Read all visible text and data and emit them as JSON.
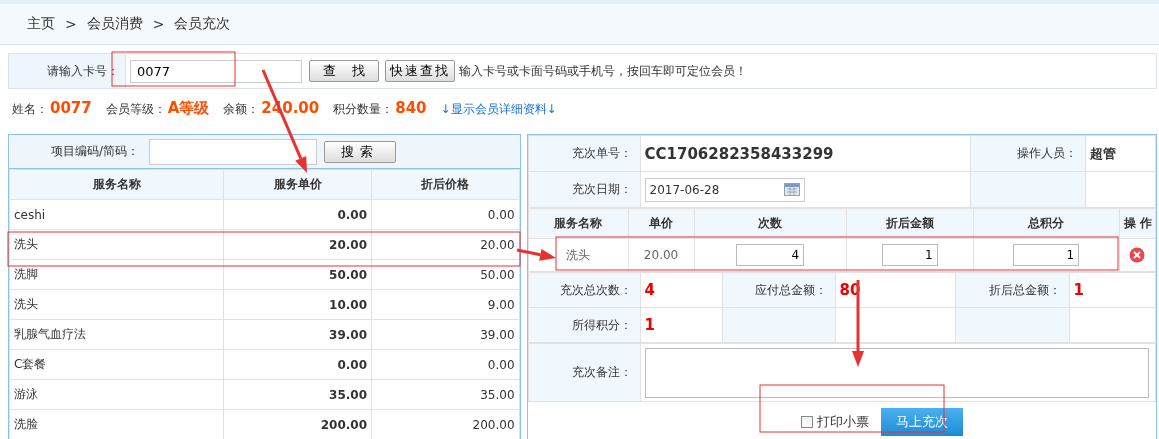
{
  "breadcrumb": [
    "主页",
    ">",
    "会员消费",
    ">",
    "会员充次"
  ],
  "card_search": {
    "label": "请输入卡号：",
    "value": "0077",
    "buttons": [
      "查 找",
      "快速查找"
    ],
    "hint": "输入卡号或卡面号码或手机号，按回车即可定位会员！"
  },
  "member_info": [
    {
      "label": "姓名：",
      "value": "0077"
    },
    {
      "label": "会员等级：",
      "value": "A等级"
    },
    {
      "label": "余额：",
      "value": "240.00"
    },
    {
      "label": "积分数量：",
      "value": "840"
    }
  ],
  "details_link": "↓显示会员详细资料↓",
  "service_panel": {
    "search_label": "项目编码/简码：",
    "search_button": "搜索",
    "columns": [
      "服务名称",
      "服务单价",
      "折后价格"
    ],
    "rows": [
      {
        "name": "ceshi",
        "price": "0.00",
        "discount_price": "0.00"
      },
      {
        "name": "洗头",
        "price": "20.00",
        "discount_price": "20.00"
      },
      {
        "name": "洗脚",
        "price": "50.00",
        "discount_price": "50.00"
      },
      {
        "name": "洗头",
        "price": "10.00",
        "discount_price": "9.00"
      },
      {
        "name": "乳腺气血疗法",
        "price": "39.00",
        "discount_price": "39.00"
      },
      {
        "name": "C套餐",
        "price": "0.00",
        "discount_price": "0.00"
      },
      {
        "name": "游泳",
        "price": "35.00",
        "discount_price": "35.00"
      },
      {
        "name": "洗脸",
        "price": "200.00",
        "discount_price": "200.00"
      }
    ]
  },
  "order_panel": {
    "order_no_label": "充次单号：",
    "order_no": "CC1706282358433299",
    "operator_label": "操作人员：",
    "operator": "超管",
    "date_label": "充次日期：",
    "date": "2017-06-28",
    "columns": [
      "服务名称",
      "单价",
      "次数",
      "折后金额",
      "总积分",
      "操 作"
    ],
    "items": [
      {
        "name": "洗头",
        "price": "20.00",
        "count": "4",
        "discount_amount": "1",
        "points": "1"
      }
    ],
    "totals": [
      {
        "label": "充次总次数：",
        "value": "4"
      },
      {
        "label": "应付总金额：",
        "value": "80"
      },
      {
        "label": "折后总金额：",
        "value": "1"
      },
      {
        "label": "所得积分：",
        "value": "1"
      }
    ],
    "remark_label": "充次备注：",
    "print_label": "打印小票",
    "print_checked": false,
    "submit_button": "马上充次"
  }
}
